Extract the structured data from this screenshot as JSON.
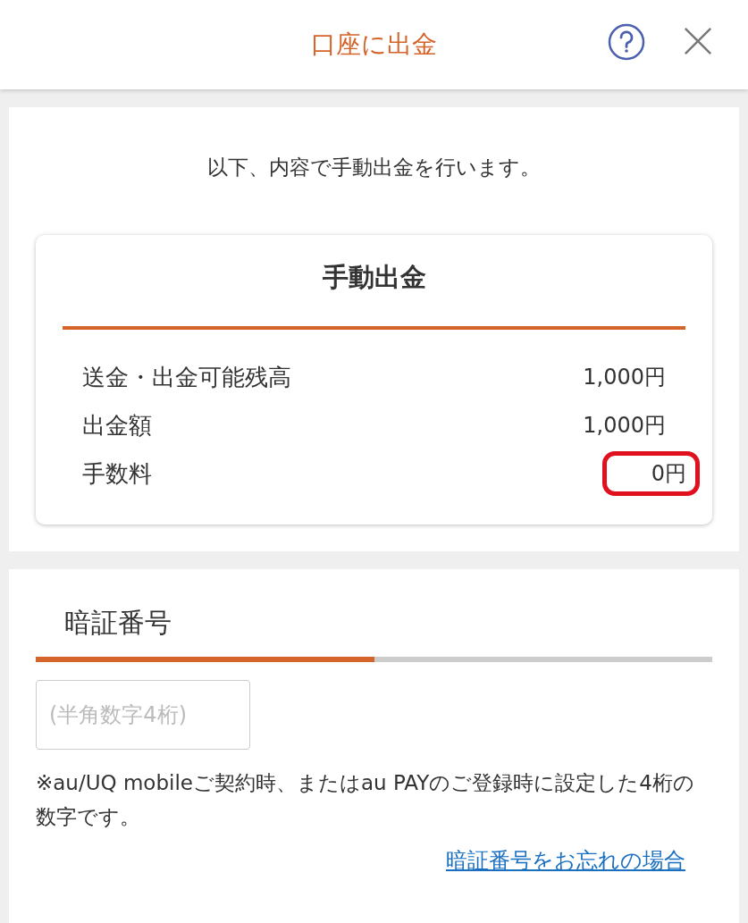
{
  "header": {
    "title": "口座に出金"
  },
  "intro": "以下、内容で手動出金を行います。",
  "summary": {
    "title": "手動出金",
    "rows": [
      {
        "label": "送金・出金可能残高",
        "value": "1,000円",
        "highlighted": false
      },
      {
        "label": "出金額",
        "value": "1,000円",
        "highlighted": false
      },
      {
        "label": "手数料",
        "value": "0円",
        "highlighted": true
      }
    ]
  },
  "pin": {
    "title": "暗証番号",
    "level": 0.5,
    "placeholder": "(半角数字4桁)",
    "note": "※au/UQ mobileご契約時、またはau PAYのご登録時に設定した4桁の数字です。",
    "link": "暗証番号をお忘れの場合"
  }
}
